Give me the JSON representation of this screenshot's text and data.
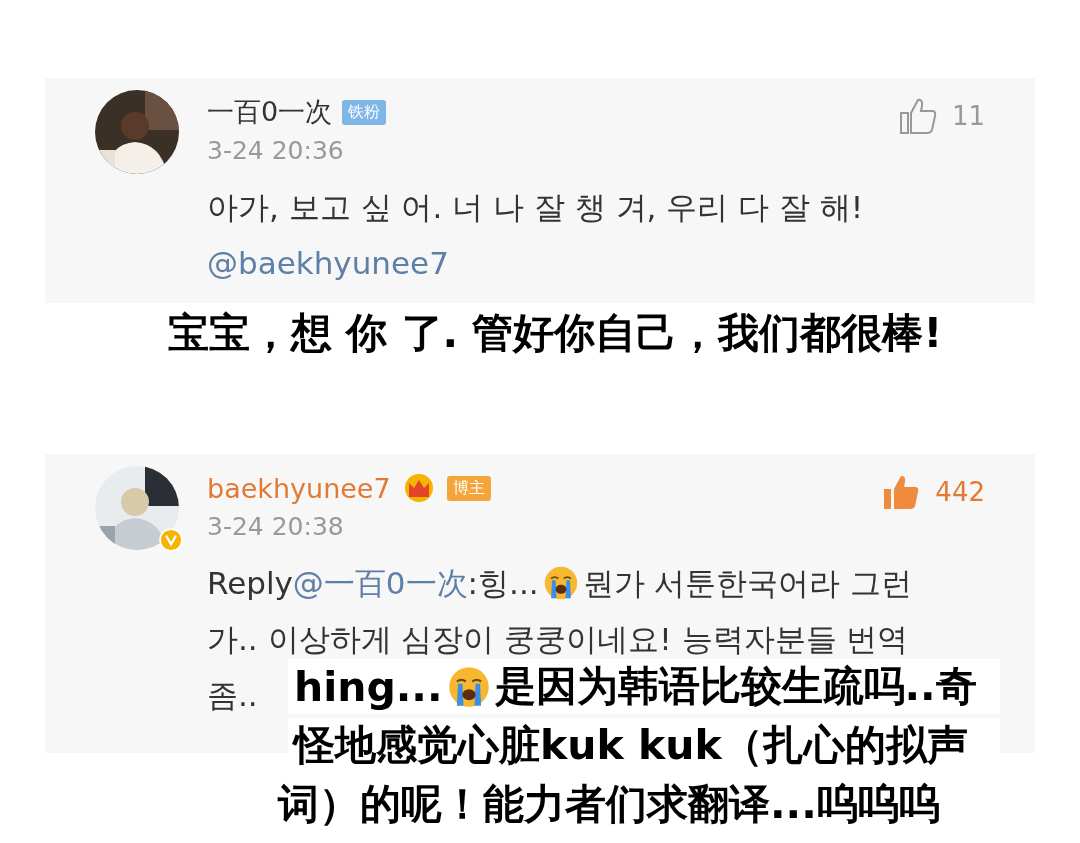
{
  "comments": [
    {
      "user": "一百0一次",
      "crown": false,
      "badge": {
        "text": "铁粉",
        "kind": "fan"
      },
      "verified": false,
      "liked": false,
      "likes": "11",
      "time": "3-24 20:36",
      "lines": [
        [
          {
            "kind": "text",
            "text": "아가, 보고 싶 어. 너 나 잘 챙 겨, 우리 다 잘 해!"
          }
        ],
        [
          {
            "kind": "mention",
            "text": "@baekhyunee7"
          }
        ]
      ],
      "caption": [
        [
          {
            "kind": "text",
            "text": "宝宝，想 你 了. 管好你自己，我们都很棒!"
          }
        ]
      ]
    },
    {
      "user": "baekhyunee7",
      "crown": true,
      "badge": {
        "text": "博主",
        "kind": "author"
      },
      "verified": true,
      "liked": true,
      "likes": "442",
      "time": "3-24 20:38",
      "lines": [
        [
          {
            "kind": "text",
            "text": "Reply"
          },
          {
            "kind": "mention",
            "text": "@一百0一次"
          },
          {
            "kind": "text",
            "text": ":힝..."
          },
          {
            "kind": "emoji"
          },
          {
            "kind": "text",
            "text": " 뭔가 서툰한국어라 그런"
          }
        ],
        [
          {
            "kind": "text",
            "text": "가.. 이상하게 심장이 쿵쿵이네요! 능력자분들 번역"
          }
        ],
        [
          {
            "kind": "text",
            "text": "좀.."
          }
        ]
      ],
      "caption": [
        [
          {
            "kind": "text",
            "text": "hing..."
          },
          {
            "kind": "emoji"
          },
          {
            "kind": "text",
            "text": "是因为韩语比较生疏吗..奇"
          }
        ],
        [
          {
            "kind": "text",
            "text": "怪地感觉心脏kuk kuk（扎心的拟声"
          }
        ],
        [
          {
            "kind": "text",
            "text": "词）的呢！能力者们求翻译...呜呜呜"
          }
        ]
      ]
    }
  ]
}
